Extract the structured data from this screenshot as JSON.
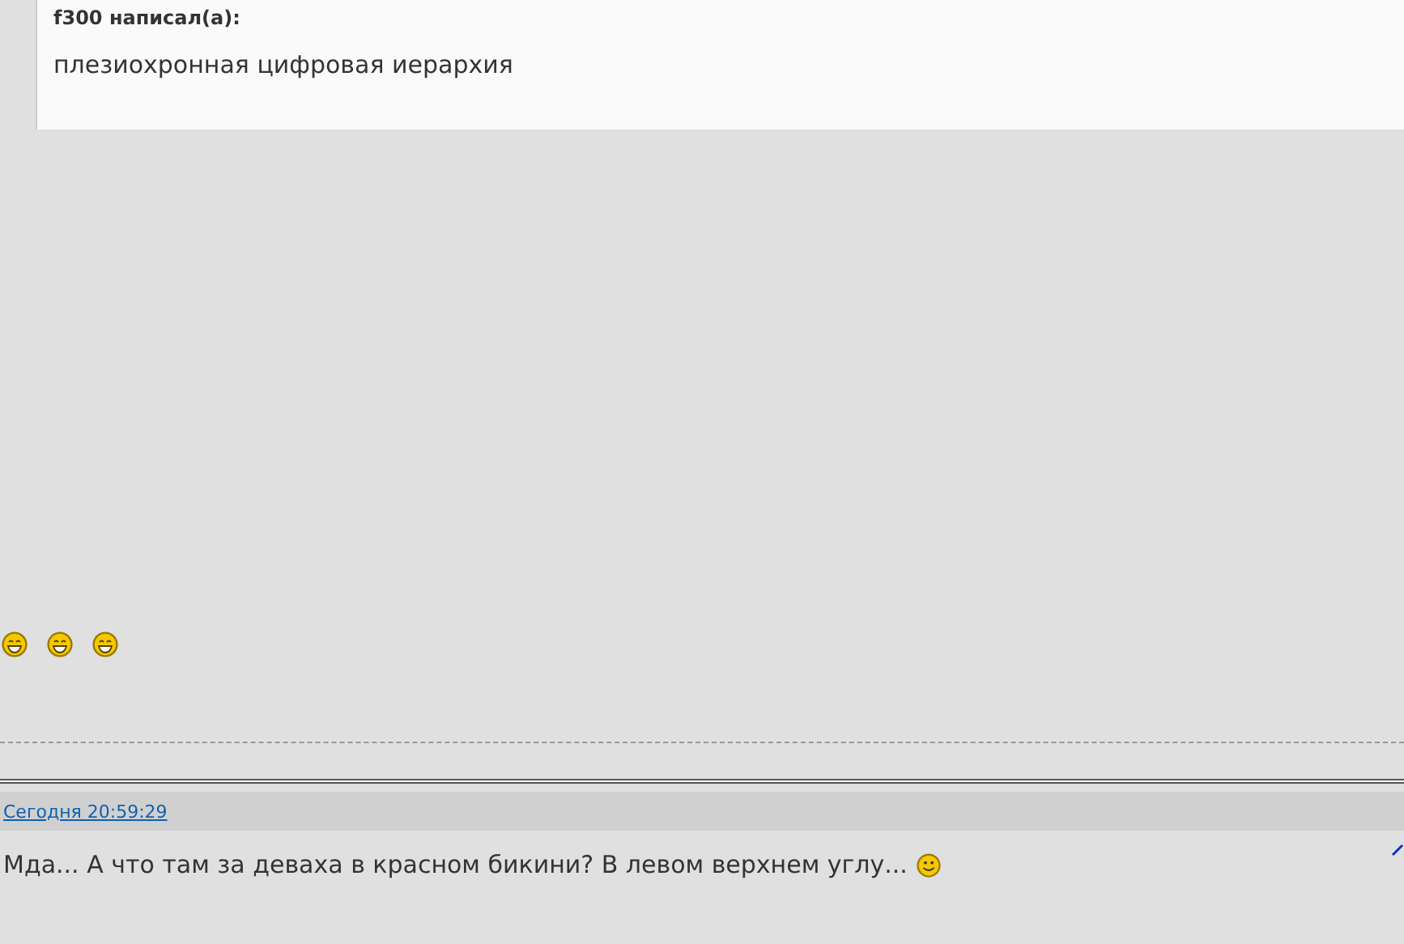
{
  "quote": {
    "author": "f300 написал(а):",
    "text": "плезиохронная цифровая иерархия"
  },
  "emoticons": [
    {
      "kind": "laugh"
    },
    {
      "kind": "laugh"
    },
    {
      "kind": "laugh"
    }
  ],
  "post": {
    "time": "Сегодня 20:59:29",
    "text": "Мда... А что там за деваха в красном бикини? В левом верхнем углу...",
    "emoticon": {
      "kind": "smile"
    }
  }
}
